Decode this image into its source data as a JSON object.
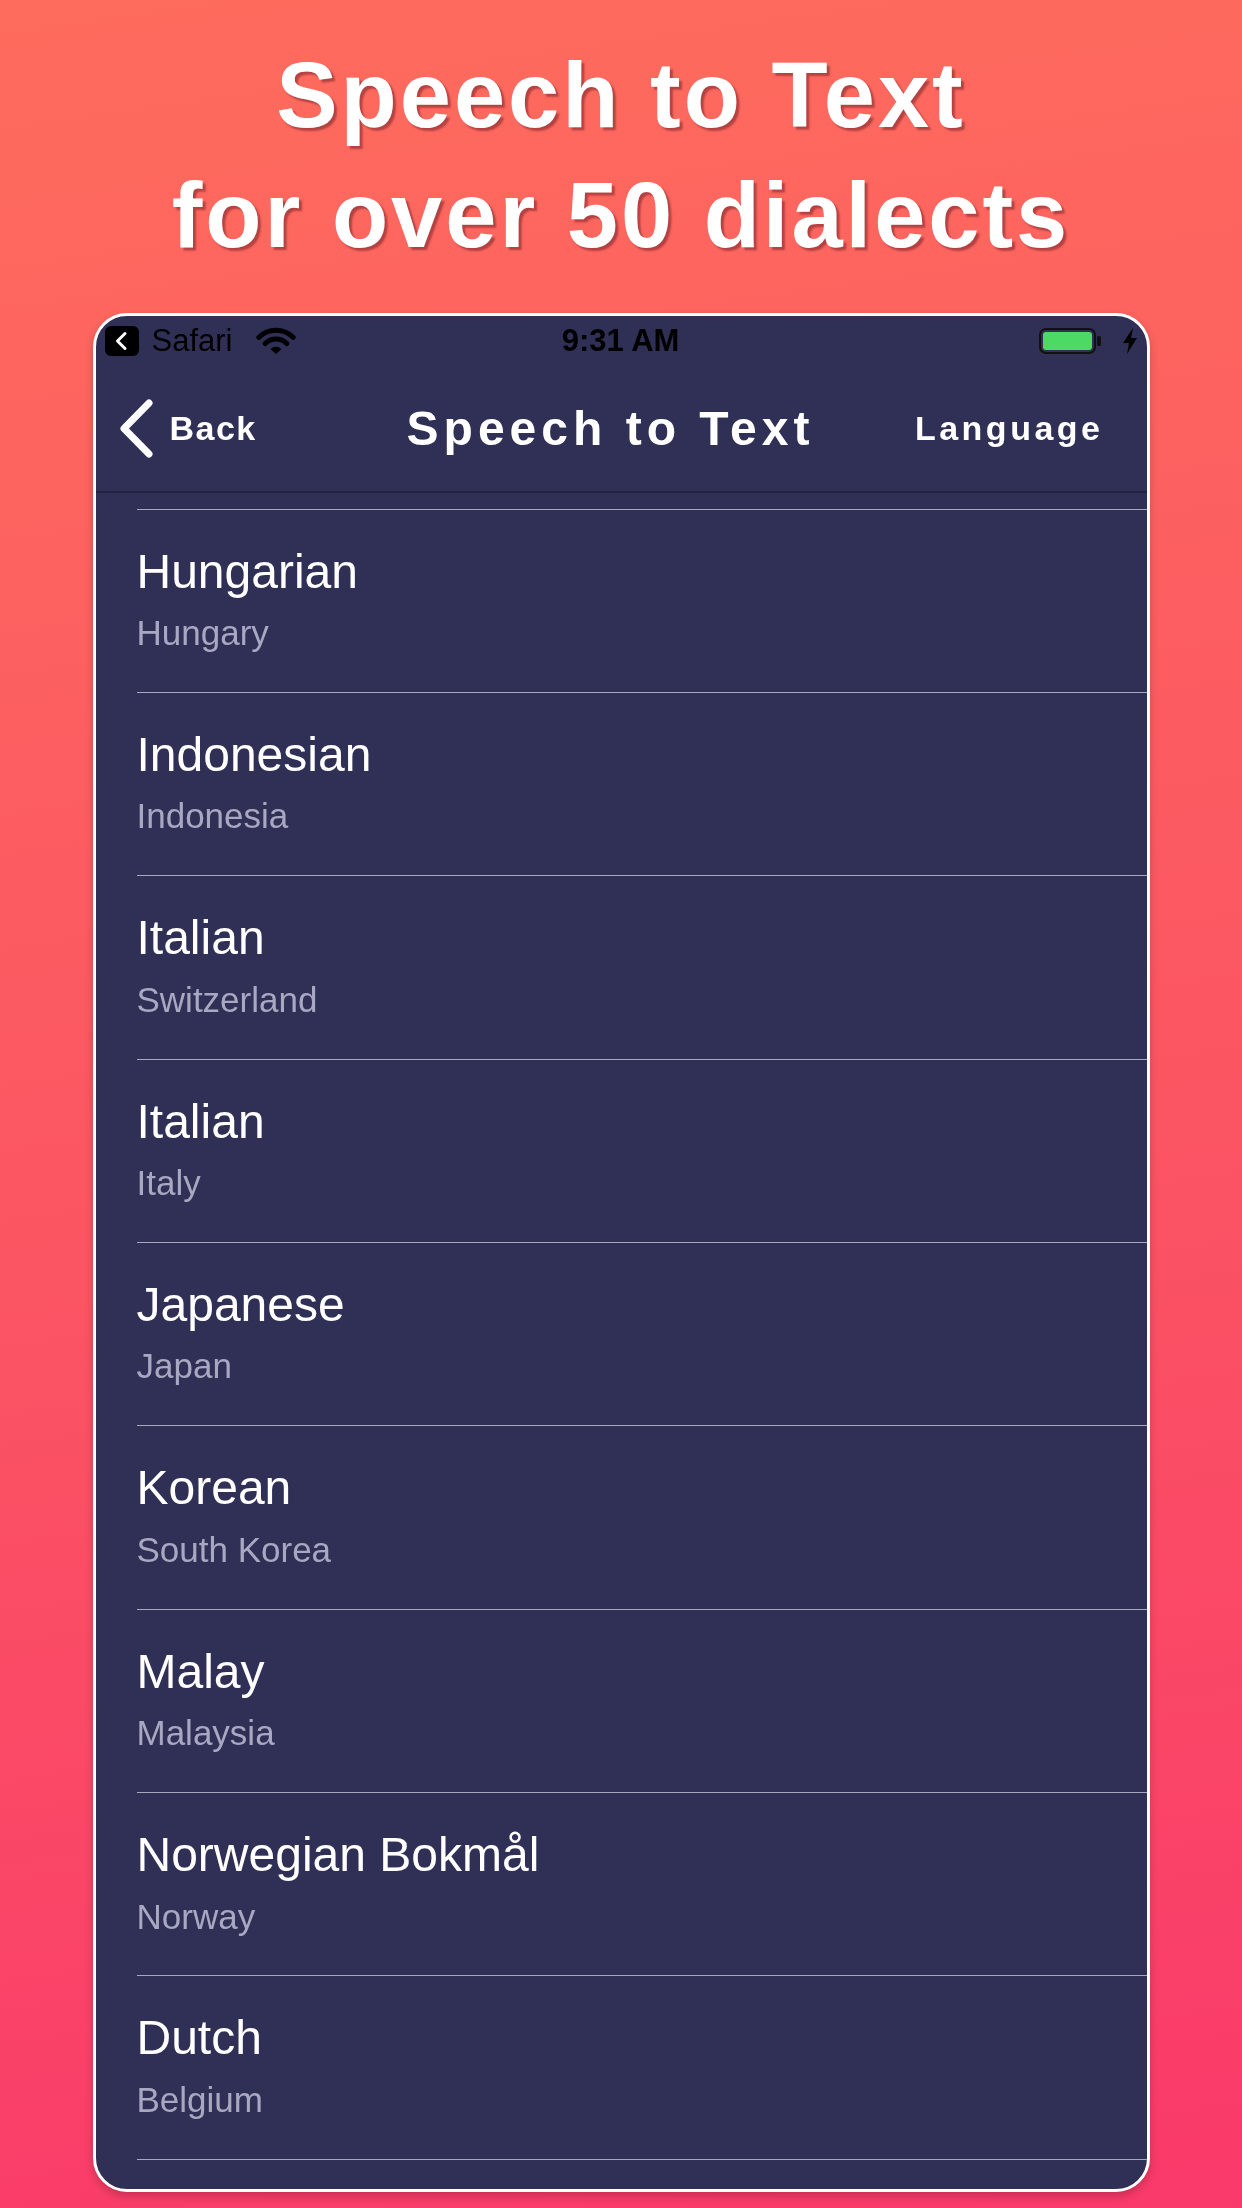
{
  "headline": [
    "Speech to Text",
    "for over 50 dialects"
  ],
  "status_bar": {
    "back_app": "Safari",
    "time": "9:31 AM"
  },
  "nav_bar": {
    "back_button": "Back",
    "title": "Speech to Text",
    "right_button": "Language"
  },
  "languages": [
    {
      "name": "Hungarian",
      "region": "Hungary"
    },
    {
      "name": "Indonesian",
      "region": "Indonesia"
    },
    {
      "name": "Italian",
      "region": "Switzerland"
    },
    {
      "name": "Italian",
      "region": "Italy"
    },
    {
      "name": "Japanese",
      "region": "Japan"
    },
    {
      "name": "Korean",
      "region": "South Korea"
    },
    {
      "name": "Malay",
      "region": "Malaysia"
    },
    {
      "name": "Norwegian Bokmål",
      "region": "Norway"
    },
    {
      "name": "Dutch",
      "region": "Belgium"
    }
  ]
}
